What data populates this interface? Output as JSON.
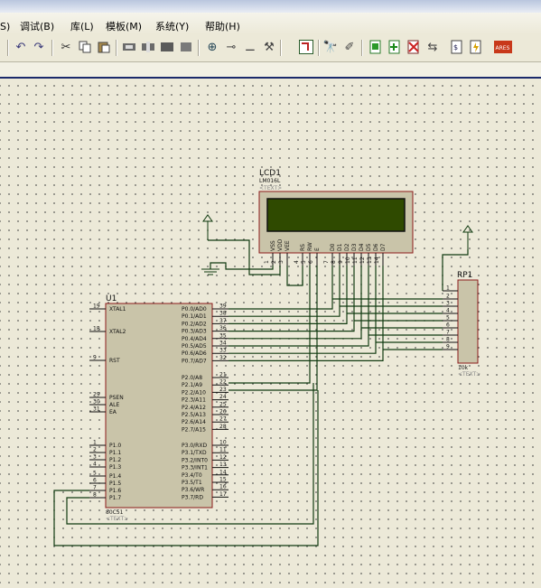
{
  "menu": {
    "items": [
      {
        "label": "S)"
      },
      {
        "label": "调试(B)"
      },
      {
        "label": "库(L)"
      },
      {
        "label": "模板(M)"
      },
      {
        "label": "系统(Y)"
      },
      {
        "label": "帮助(H)"
      }
    ]
  },
  "toolbar": {
    "icons": [
      "undo-icon",
      "redo-icon",
      "cut-icon",
      "copy-icon",
      "paste-icon",
      "block-copy-icon",
      "block-move-icon",
      "block-rotate-icon",
      "block-delete-icon",
      "pick-device-icon",
      "make-device-icon",
      "packaging-icon",
      "decompose-icon",
      "wire-autoroute-icon",
      "search-icon",
      "property-assign-icon",
      "new-sheet-icon",
      "add-sheet-icon",
      "remove-sheet-icon",
      "goto-sheet-icon",
      "bill-of-materials-icon",
      "electrical-check-icon",
      "ares-netlist-icon"
    ],
    "ares_label": "ARES"
  },
  "schematic": {
    "lcd": {
      "ref": "LCD1",
      "part": "LM016L",
      "text": "<TEXT>",
      "pins": [
        "VSS",
        "VDD",
        "VEE",
        "RS",
        "RW",
        "E",
        "D0",
        "D1",
        "D2",
        "D3",
        "D4",
        "D5",
        "D6",
        "D7"
      ],
      "pin_numbers": [
        "1",
        "2",
        "3",
        "4",
        "5",
        "6",
        "7",
        "8",
        "9",
        "10",
        "11",
        "12",
        "13",
        "14"
      ]
    },
    "rp": {
      "ref": "RP1",
      "value": "10k",
      "text": "<TEXT>",
      "pin_numbers": [
        "1",
        "2",
        "3",
        "4",
        "5",
        "6",
        "7",
        "8",
        "9"
      ]
    },
    "mcu": {
      "ref": "U1",
      "part": "80C51",
      "text": "<TEXT>",
      "left_pins": [
        {
          "num": "19",
          "name": "XTAL1"
        },
        {
          "num": "18",
          "name": "XTAL2"
        },
        {
          "num": "9",
          "name": "RST"
        },
        {
          "num": "29",
          "name": "PSEN"
        },
        {
          "num": "30",
          "name": "ALE"
        },
        {
          "num": "31",
          "name": "EA"
        },
        {
          "num": "1",
          "name": "P1.0"
        },
        {
          "num": "2",
          "name": "P1.1"
        },
        {
          "num": "3",
          "name": "P1.2"
        },
        {
          "num": "4",
          "name": "P1.3"
        },
        {
          "num": "5",
          "name": "P1.4"
        },
        {
          "num": "6",
          "name": "P1.5"
        },
        {
          "num": "7",
          "name": "P1.6"
        },
        {
          "num": "8",
          "name": "P1.7"
        }
      ],
      "right_pins": [
        {
          "num": "39",
          "name": "P0.0/AD0"
        },
        {
          "num": "38",
          "name": "P0.1/AD1"
        },
        {
          "num": "37",
          "name": "P0.2/AD2"
        },
        {
          "num": "36",
          "name": "P0.3/AD3"
        },
        {
          "num": "35",
          "name": "P0.4/AD4"
        },
        {
          "num": "34",
          "name": "P0.5/AD5"
        },
        {
          "num": "33",
          "name": "P0.6/AD6"
        },
        {
          "num": "32",
          "name": "P0.7/AD7"
        },
        {
          "num": "21",
          "name": "P2.0/A8"
        },
        {
          "num": "22",
          "name": "P2.1/A9"
        },
        {
          "num": "23",
          "name": "P2.2/A10"
        },
        {
          "num": "24",
          "name": "P2.3/A11"
        },
        {
          "num": "25",
          "name": "P2.4/A12"
        },
        {
          "num": "26",
          "name": "P2.5/A13"
        },
        {
          "num": "27",
          "name": "P2.6/A14"
        },
        {
          "num": "28",
          "name": "P2.7/A15"
        },
        {
          "num": "10",
          "name": "P3.0/RXD"
        },
        {
          "num": "11",
          "name": "P3.1/TXD"
        },
        {
          "num": "12",
          "name": "P3.2/INT0"
        },
        {
          "num": "13",
          "name": "P3.3/INT1"
        },
        {
          "num": "14",
          "name": "P3.4/T0"
        },
        {
          "num": "15",
          "name": "P3.5/T1"
        },
        {
          "num": "16",
          "name": "P3.6/WR"
        },
        {
          "num": "17",
          "name": "P3.7/RD"
        }
      ]
    }
  },
  "colors": {
    "wire": "#103a10",
    "body": "#c9c4a9",
    "border": "#8b1a1a",
    "lcd_screen": "#2f4a00"
  }
}
